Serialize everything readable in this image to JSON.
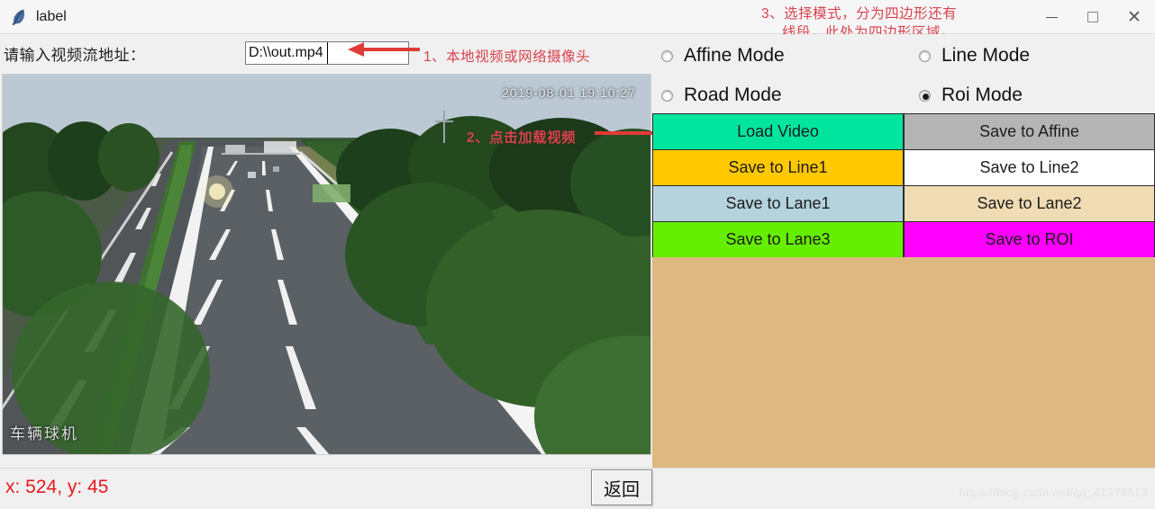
{
  "window": {
    "title": "label",
    "icon": "feather-icon",
    "minimize": "—",
    "maximize": "□",
    "close": "✕"
  },
  "form": {
    "url_label": "请输入视频流地址：",
    "url_value": "D:\\\\out.mp4",
    "url_placeholder": "D:\\\\out.mp4"
  },
  "annotations": {
    "note1": "1、本地视频或网络摄像头",
    "note2": "2、点击加载视频",
    "note3_line1": "3、选择模式，分为四边形还有",
    "note3_line2": "线段，此处为四边形区域。",
    "color": "#d9434d"
  },
  "video": {
    "timestamp": "2019-08-01 19:10:27",
    "camera_label": "车辆球机"
  },
  "modes": [
    {
      "label": "Affine Mode",
      "selected": false
    },
    {
      "label": "Line Mode",
      "selected": false
    },
    {
      "label": "Road Mode",
      "selected": false
    },
    {
      "label": "Roi Mode",
      "selected": true
    }
  ],
  "buttons": [
    {
      "label": "Load Video",
      "bg": "#00e59e",
      "fg": "#1d1d1d"
    },
    {
      "label": "Save to Affine",
      "bg": "#b4b4b4",
      "fg": "#1d1d1d"
    },
    {
      "label": "Save to Line1",
      "bg": "#ffc800",
      "fg": "#1d1d1d"
    },
    {
      "label": "Save to Line2",
      "bg": "#ffffff",
      "fg": "#1d1d1d"
    },
    {
      "label": "Save to Lane1",
      "bg": "#b4d3dc",
      "fg": "#1d1d1d"
    },
    {
      "label": "Save to Lane2",
      "bg": "#f0dcb4",
      "fg": "#1d1d1d"
    },
    {
      "label": "Save to Lane3",
      "bg": "#66ee00",
      "fg": "#1d1d1d"
    },
    {
      "label": "Save to ROI",
      "bg": "#ff00ff",
      "fg": "#1d1d1d"
    }
  ],
  "panel": {
    "background": "#deb881"
  },
  "status": {
    "coords": "x: 524, y: 45",
    "coords_color": "#e8191f",
    "back_button": "返回"
  },
  "watermark": "https://blog.csdn.net/qq_41979513"
}
